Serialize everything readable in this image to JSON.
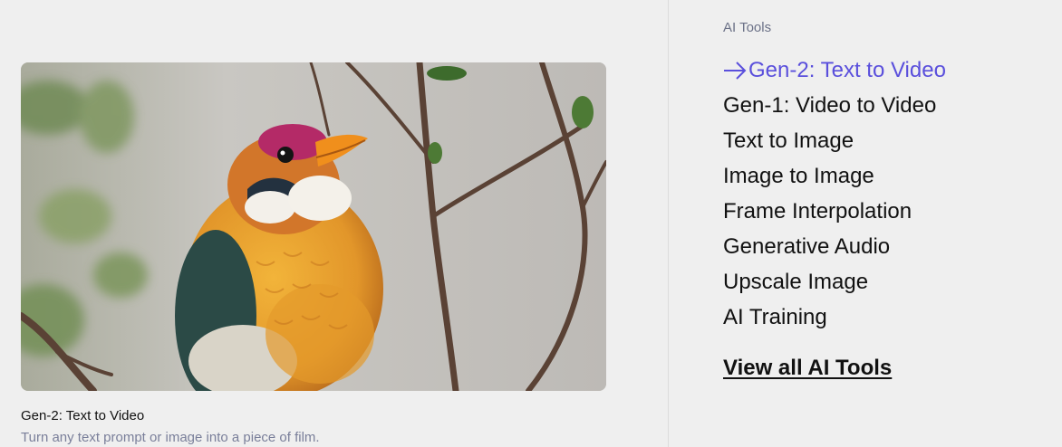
{
  "preview": {
    "caption_title": "Gen-2: Text to Video",
    "caption_description": "Turn any text prompt or image into a piece of film."
  },
  "sidebar": {
    "section_label": "AI Tools",
    "items": [
      {
        "label": "Gen-2: Text to Video",
        "active": true,
        "icon": "arrow-right-icon"
      },
      {
        "label": "Gen-1: Video to Video",
        "active": false
      },
      {
        "label": "Text to Image",
        "active": false
      },
      {
        "label": "Image to Image",
        "active": false
      },
      {
        "label": "Frame Interpolation",
        "active": false
      },
      {
        "label": "Generative Audio",
        "active": false
      },
      {
        "label": "Upscale Image",
        "active": false
      },
      {
        "label": "AI Training",
        "active": false
      }
    ],
    "view_all_label": "View all AI Tools",
    "accent_color": "#5a4fdc"
  }
}
